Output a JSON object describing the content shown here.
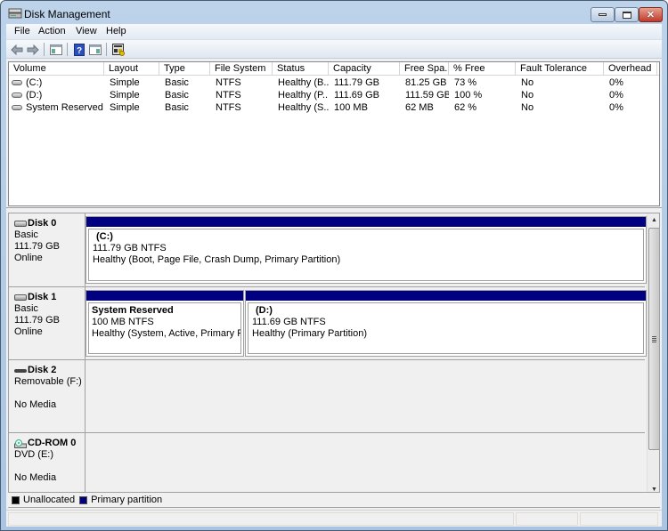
{
  "window": {
    "title": "Disk Management",
    "controls": {
      "minimize": "minimize",
      "maximize": "maximize",
      "close": "close"
    }
  },
  "menu": [
    "File",
    "Action",
    "View",
    "Help"
  ],
  "toolbar": {
    "buttons": [
      {
        "name": "back",
        "icon": "arrow-left-icon"
      },
      {
        "name": "forward",
        "icon": "arrow-right-icon"
      },
      {
        "name": "show-hide-console-tree",
        "icon": "console-tree-icon"
      },
      {
        "name": "help",
        "icon": "help-icon",
        "glyph": "?"
      },
      {
        "name": "show-hide-action-pane",
        "icon": "action-pane-icon"
      },
      {
        "name": "properties",
        "icon": "properties-icon"
      }
    ]
  },
  "volume_list": {
    "columns": [
      "Volume",
      "Layout",
      "Type",
      "File System",
      "Status",
      "Capacity",
      "Free Spa...",
      "% Free",
      "Fault Tolerance",
      "Overhead"
    ],
    "rows": [
      [
        "(C:)",
        "Simple",
        "Basic",
        "NTFS",
        "Healthy (B...",
        "111.79 GB",
        "81.25 GB",
        "73 %",
        "No",
        "0%"
      ],
      [
        "(D:)",
        "Simple",
        "Basic",
        "NTFS",
        "Healthy (P...",
        "111.69 GB",
        "111.59 GB",
        "100 %",
        "No",
        "0%"
      ],
      [
        "System Reserved",
        "Simple",
        "Basic",
        "NTFS",
        "Healthy (S...",
        "100 MB",
        "62 MB",
        "62 %",
        "No",
        "0%"
      ]
    ]
  },
  "disks": [
    {
      "name": "Disk 0",
      "type": "Basic",
      "size": "111.79 GB",
      "state": "Online",
      "partitions": [
        {
          "title": "(C:)",
          "fs": "111.79 GB NTFS",
          "status": "Healthy (Boot, Page File, Crash Dump, Primary Partition)"
        }
      ]
    },
    {
      "name": "Disk 1",
      "type": "Basic",
      "size": "111.79 GB",
      "state": "Online",
      "partitions": [
        {
          "title": "System Reserved",
          "fs": "100 MB NTFS",
          "status": "Healthy (System, Active, Primary Partit"
        },
        {
          "title": "(D:)",
          "fs": "111.69 GB NTFS",
          "status": "Healthy (Primary Partition)"
        }
      ]
    },
    {
      "name": "Disk 2",
      "type": "Removable (F:)",
      "state": "No Media",
      "partitions": []
    },
    {
      "name": "CD-ROM 0",
      "type": "DVD (E:)",
      "state": "No Media",
      "partitions": []
    }
  ],
  "legend": [
    {
      "label": "Unallocated",
      "color": "#000000"
    },
    {
      "label": "Primary partition",
      "color": "#000080"
    }
  ],
  "colors": {
    "primary_partition": "#000080",
    "unallocated": "#000000"
  }
}
